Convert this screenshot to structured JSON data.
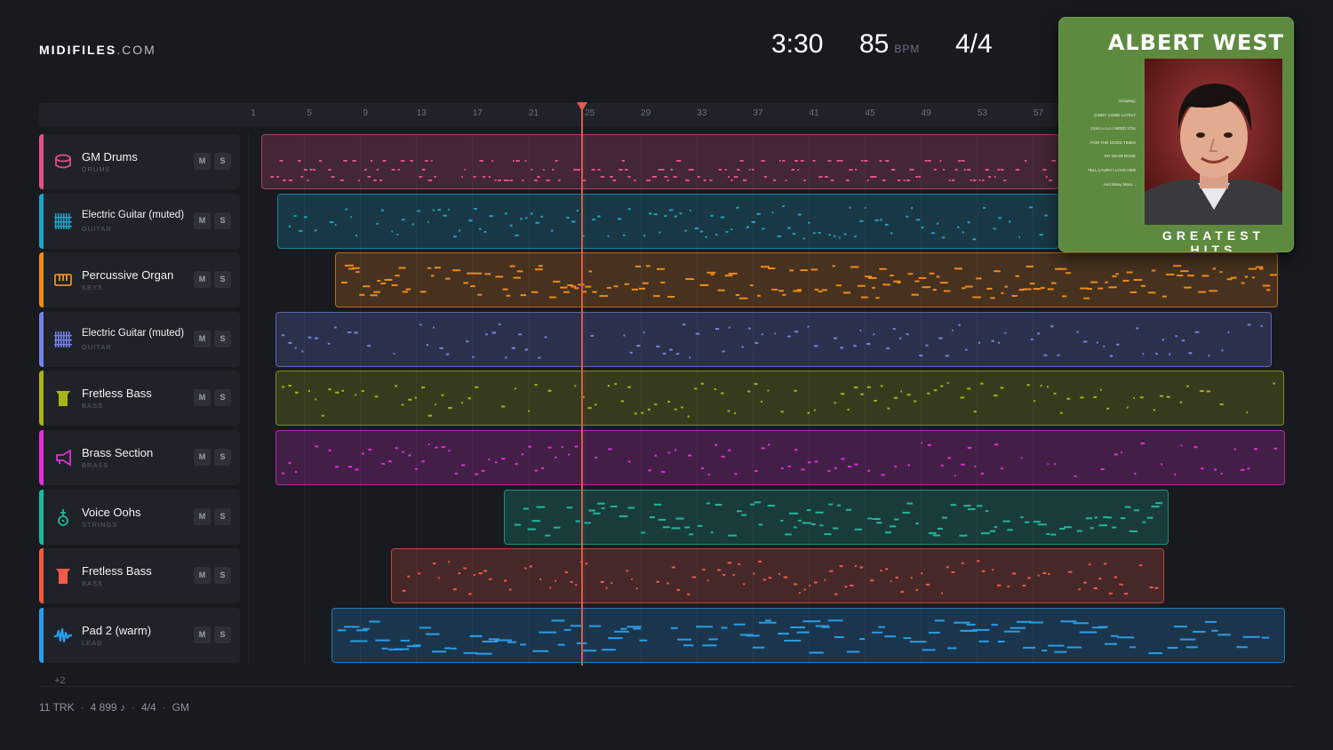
{
  "brand": {
    "bold": "MIDIFILES",
    "light": ".COM"
  },
  "transport": {
    "time": "3:30",
    "tempo": "85",
    "tempo_unit": "BPM",
    "meter": "4/4"
  },
  "ruler": {
    "ticks": [
      "1",
      "5",
      "9",
      "13",
      "17",
      "21",
      "25",
      "29",
      "33",
      "37",
      "41",
      "45",
      "49",
      "53",
      "57"
    ]
  },
  "tracks": [
    {
      "name": "GM Drums",
      "category": "DRUMS",
      "color": "#e0508a",
      "icon": "drum-icon",
      "mute": "M",
      "solo": "S"
    },
    {
      "name": "Electric Guitar (muted)",
      "category": "GUITAR",
      "color": "#1fa3c8",
      "icon": "guitar-icon",
      "mute": "M",
      "solo": "S"
    },
    {
      "name": "Percussive Organ",
      "category": "KEYS",
      "color": "#ef8a1a",
      "icon": "keys-icon",
      "mute": "M",
      "solo": "S"
    },
    {
      "name": "Electric Guitar (muted)",
      "category": "GUITAR",
      "color": "#7482e8",
      "icon": "guitar-icon",
      "mute": "M",
      "solo": "S"
    },
    {
      "name": "Fretless Bass",
      "category": "BASS",
      "color": "#a8b317",
      "icon": "bass-icon",
      "mute": "M",
      "solo": "S"
    },
    {
      "name": "Brass Section",
      "category": "BRASS",
      "color": "#e030d8",
      "icon": "trumpet-icon",
      "mute": "M",
      "solo": "S"
    },
    {
      "name": "Voice Oohs",
      "category": "STRINGS",
      "color": "#1fb89c",
      "icon": "violin-icon",
      "mute": "M",
      "solo": "S"
    },
    {
      "name": "Fretless Bass",
      "category": "BASS",
      "color": "#f05a44",
      "icon": "bass-icon",
      "mute": "M",
      "solo": "S"
    },
    {
      "name": "Pad 2 (warm)",
      "category": "LEAD",
      "color": "#2a9de8",
      "icon": "wave-icon",
      "mute": "M",
      "solo": "S"
    }
  ],
  "more_tracks": "+2",
  "footer": {
    "tracks": "11 TRK",
    "notes": "4 899 ♪",
    "meter": "4/4",
    "standard": "GM"
  },
  "cover": {
    "artist": "ALBERT WEST",
    "subtitle": "GREATEST HITS",
    "tracklist": [
      "Including:",
      "GINNY COME LATELY",
      "CHA LA LA I NEED YOU",
      "FOR THE GOOD TIMES",
      "MY DEAR ROSE",
      "TELL LAURA I LOVE HER",
      "And Many More..."
    ]
  }
}
